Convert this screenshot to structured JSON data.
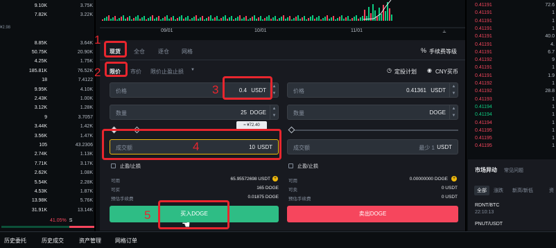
{
  "left_orderbook": {
    "rows": [
      {
        "a": "9.10K",
        "b": "3.75K",
        "color": "#eaecef"
      },
      {
        "a": "7.82K",
        "b": "3.22K",
        "color": "#eaecef"
      },
      {
        "a": "",
        "b": "",
        "color": "#eaecef"
      },
      {
        "a": "",
        "b": "",
        "color": "#eaecef"
      },
      {
        "a": "8.85K",
        "b": "3.64K",
        "color": "#eaecef"
      },
      {
        "a": "50.75K",
        "b": "20.90K",
        "color": "#eaecef"
      },
      {
        "a": "4.25K",
        "b": "1.75K",
        "color": "#eaecef"
      },
      {
        "a": "185.81K",
        "b": "76.52K",
        "color": "#eaecef"
      },
      {
        "a": "18",
        "b": "7.4122",
        "color": "#eaecef"
      },
      {
        "a": "9.95K",
        "b": "4.10K",
        "color": "#eaecef"
      },
      {
        "a": "2.43K",
        "b": "1.00K",
        "color": "#eaecef"
      },
      {
        "a": "3.12K",
        "b": "1.28K",
        "color": "#eaecef"
      },
      {
        "a": "9",
        "b": "3.7057",
        "color": "#eaecef"
      },
      {
        "a": "3.44K",
        "b": "1.42K",
        "color": "#eaecef"
      },
      {
        "a": "3.56K",
        "b": "1.47K",
        "color": "#eaecef"
      },
      {
        "a": "105",
        "b": "43.2306",
        "color": "#eaecef"
      },
      {
        "a": "2.74K",
        "b": "1.13K",
        "color": "#eaecef"
      },
      {
        "a": "7.71K",
        "b": "3.17K",
        "color": "#eaecef"
      },
      {
        "a": "2.62K",
        "b": "1.08K",
        "color": "#eaecef"
      },
      {
        "a": "5.54K",
        "b": "2.28K",
        "color": "#eaecef"
      },
      {
        "a": "4.53K",
        "b": "1.87K",
        "color": "#eaecef"
      },
      {
        "a": "13.98K",
        "b": "5.76K",
        "color": "#eaecef"
      },
      {
        "a": "31.91K",
        "b": "13.14K",
        "color": "#eaecef"
      }
    ],
    "small_label": "¥2.98",
    "pct_text": "41.05%",
    "pct_suffix": "S"
  },
  "bottom_tabs": [
    "历史委托",
    "历史成交",
    "资产管理",
    "网格订单"
  ],
  "chart": {
    "dates": [
      "09/01",
      "10/01",
      "11/01"
    ]
  },
  "trade_tabs": {
    "items": [
      "现货",
      "全仓",
      "逐仓",
      "网格"
    ],
    "fee_label": "手续费等级"
  },
  "order_types": {
    "items": [
      "限价",
      "市价",
      "限价止盈止损"
    ],
    "plan_label": "定投计划",
    "cny_label": "CNY买币"
  },
  "buy": {
    "price_label": "价格",
    "price_value": "0.4",
    "price_unit": "USDT",
    "qty_label": "数量",
    "qty_value": "25",
    "qty_unit": "DOGE",
    "tooltip": "≈ ¥72.40",
    "total_label": "成交额",
    "total_value": "10",
    "total_unit": "USDT",
    "tpsl_label": "止盈/止损",
    "avail_label": "可用",
    "avail_value": "65.95572698 USDT",
    "max_label": "可买",
    "max_value": "165 DOGE",
    "fee_label": "预估手续费",
    "fee_value": "0.01875 DOGE",
    "button": "买入DOGE"
  },
  "sell": {
    "price_label": "价格",
    "price_value": "0.41361",
    "price_unit": "USDT",
    "qty_label": "数量",
    "qty_unit": "DOGE",
    "total_label": "成交额",
    "total_hint": "最少 1",
    "total_unit": "USDT",
    "tpsl_label": "止盈/止损",
    "avail_label": "可用",
    "avail_value": "0.00000000 DOGE",
    "max_label": "可卖",
    "max_value": "0 USDT",
    "fee_label": "预估手续费",
    "fee_value": "0 USDT",
    "button": "卖出DOGE"
  },
  "right_list": {
    "rows": [
      {
        "p": "0.41191",
        "q": "72.6",
        "color": "#f6465d"
      },
      {
        "p": "0.41191",
        "q": "1",
        "color": "#f6465d"
      },
      {
        "p": "0.41191",
        "q": "1",
        "color": "#f6465d"
      },
      {
        "p": "0.41191",
        "q": "1",
        "color": "#f6465d"
      },
      {
        "p": "0.41191",
        "q": "40.0",
        "color": "#f6465d"
      },
      {
        "p": "0.41191",
        "q": "4.",
        "color": "#f6465d"
      },
      {
        "p": "0.41191",
        "q": "6.7",
        "color": "#f6465d"
      },
      {
        "p": "0.41192",
        "q": "9",
        "color": "#f6465d"
      },
      {
        "p": "0.41191",
        "q": "1",
        "color": "#f6465d"
      },
      {
        "p": "0.41191",
        "q": "1.9",
        "color": "#f6465d"
      },
      {
        "p": "0.41192",
        "q": "1",
        "color": "#f6465d"
      },
      {
        "p": "0.41192",
        "q": "28.8",
        "color": "#f6465d"
      },
      {
        "p": "0.41193",
        "q": "1",
        "color": "#f6465d"
      },
      {
        "p": "0.41194",
        "q": "1",
        "color": "#0ecb81"
      },
      {
        "p": "0.41194",
        "q": "1",
        "color": "#0ecb81"
      },
      {
        "p": "0.41194",
        "q": "1",
        "color": "#f6465d"
      },
      {
        "p": "0.41195",
        "q": "1",
        "color": "#f6465d"
      },
      {
        "p": "0.41195",
        "q": "1",
        "color": "#f6465d"
      },
      {
        "p": "0.41195",
        "q": "1",
        "color": "#f6465d"
      }
    ]
  },
  "market": {
    "title": "市场异动",
    "subtitle": "常见问题",
    "filters": [
      "全部",
      "涨跌",
      "新高/新低",
      "资"
    ],
    "entries": [
      {
        "pair": "RDNT/BTC",
        "time": "22:10:13"
      },
      {
        "pair": "PNUT/USDT",
        "time": ""
      }
    ]
  },
  "annotations": [
    "1",
    "2",
    "3",
    "4",
    "5"
  ],
  "colors": {
    "red": "#e8262e",
    "buy_green": "#2ebd85",
    "sell_red": "#f6465d"
  }
}
